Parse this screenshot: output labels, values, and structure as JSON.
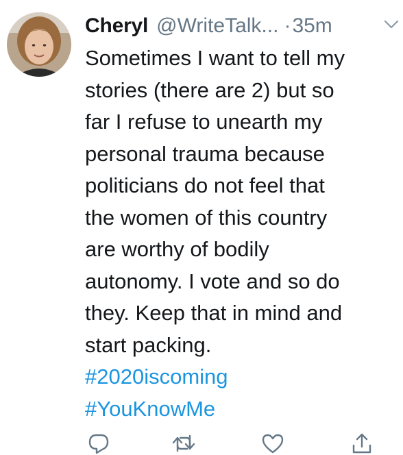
{
  "tweet": {
    "author": {
      "name": "Cheryl",
      "handle": "@WriteTalk...",
      "avatar_icon": "avatar-photo"
    },
    "separator": "·",
    "timestamp": "35m",
    "menu_icon": "chevron-down-icon",
    "text_lines": [
      "Sometimes I want to tell my",
      "stories (there are 2) but so",
      "far I refuse to unearth my",
      "personal trauma because",
      "politicians do not feel that",
      "the women of this country",
      "are worthy of bodily",
      "autonomy. I vote and so do",
      "they. Keep that in mind and",
      "start packing."
    ],
    "hashtags": [
      "#2020iscoming",
      "#YouKnowMe"
    ],
    "actions": [
      "reply-icon",
      "retweet-icon",
      "like-icon",
      "share-icon"
    ]
  },
  "colors": {
    "text": "#14171a",
    "secondary": "#657786",
    "link": "#1b95e0"
  }
}
